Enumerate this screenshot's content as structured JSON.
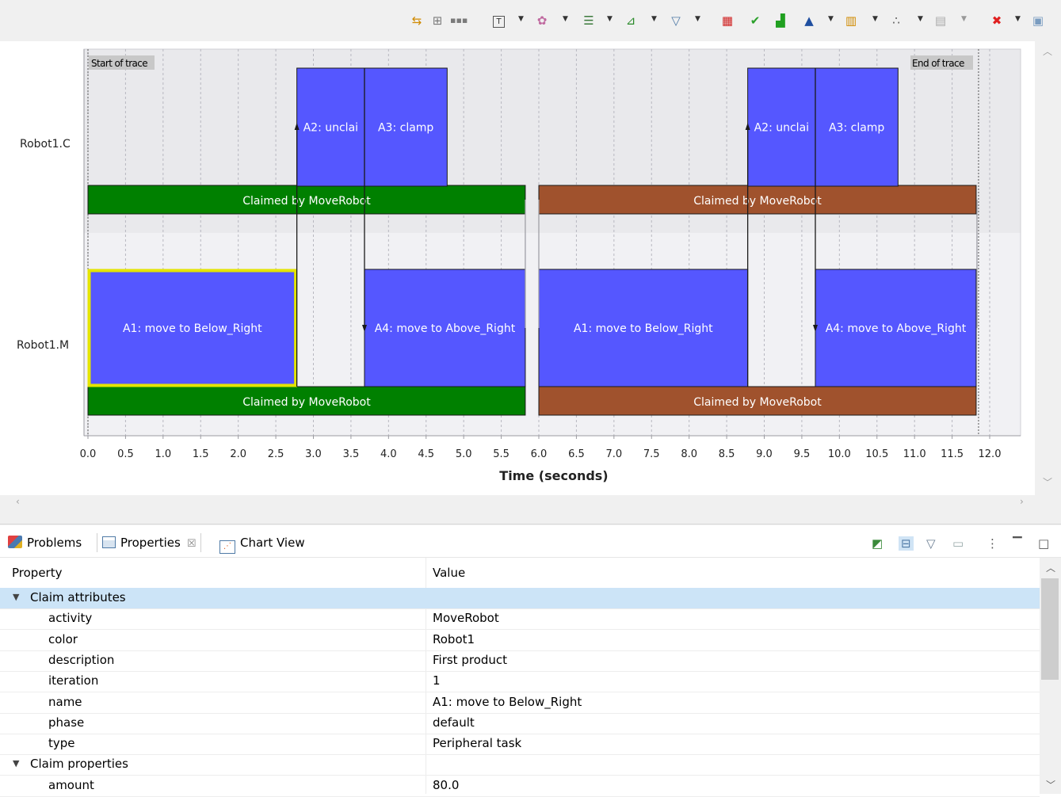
{
  "toolbar": {
    "icons": [
      "sync-icon",
      "hierarchy-icon",
      "ellipsis-icon",
      "text-icon",
      "color-palette-icon",
      "rows-icon",
      "pin-icon",
      "filter-icon",
      "matrix-icon",
      "check-icon",
      "histogram-icon",
      "triangle-icon",
      "bar-chart-icon",
      "scatter-icon",
      "columns-icon",
      "delete-icon",
      "save-icon"
    ]
  },
  "chart": {
    "start_label": "Start of trace",
    "end_label": "End of trace",
    "xlabel": "Time (seconds)",
    "rows": [
      "Robot1.C",
      "Robot1.M"
    ],
    "ticks": [
      "0.0",
      "0.5",
      "1.0",
      "1.5",
      "2.0",
      "2.5",
      "3.0",
      "3.5",
      "4.0",
      "4.5",
      "5.0",
      "5.5",
      "6.0",
      "6.5",
      "7.0",
      "7.5",
      "8.0",
      "8.5",
      "9.0",
      "9.5",
      "10.0",
      "10.5",
      "11.0",
      "11.5",
      "12.0"
    ]
  },
  "chart_data": {
    "type": "gantt",
    "xlabel": "Time (seconds)",
    "xlim": [
      0.0,
      12.0
    ],
    "rows": [
      "Robot1.C",
      "Robot1.M"
    ],
    "colors": {
      "task": "#5557ff",
      "claim_1": "#008000",
      "claim_2": "#a0522d",
      "selected": "#e4e400"
    },
    "tasks": [
      {
        "row": 0,
        "label": "A2: unclai",
        "start": 2.78,
        "end": 3.68
      },
      {
        "row": 0,
        "label": "A3: clamp",
        "start": 3.68,
        "end": 4.78
      },
      {
        "row": 0,
        "label": "A2: unclai",
        "start": 8.78,
        "end": 9.68
      },
      {
        "row": 0,
        "label": "A3: clamp",
        "start": 9.68,
        "end": 10.78
      },
      {
        "row": 1,
        "label": "A1: move to Below_Right",
        "start": 0.0,
        "end": 2.78,
        "selected": true
      },
      {
        "row": 1,
        "label": "A4: move to Above_Right",
        "start": 3.68,
        "end": 5.82
      },
      {
        "row": 1,
        "label": "A1: move to Below_Right",
        "start": 6.0,
        "end": 8.78
      },
      {
        "row": 1,
        "label": "A4: move to Above_Right",
        "start": 9.68,
        "end": 11.82
      }
    ],
    "claims": [
      {
        "row": 0,
        "label": "Claimed by MoveRobot",
        "start": 0.0,
        "end": 5.82,
        "color": "#008000"
      },
      {
        "row": 0,
        "label": "Claimed by MoveRobot",
        "start": 6.0,
        "end": 11.82,
        "color": "#a0522d"
      },
      {
        "row": 1,
        "label": "Claimed by MoveRobot",
        "start": 0.0,
        "end": 5.82,
        "color": "#008000"
      },
      {
        "row": 1,
        "label": "Claimed by MoveRobot",
        "start": 6.0,
        "end": 11.82,
        "color": "#a0522d"
      }
    ],
    "dependencies": [
      {
        "from_row": 1,
        "to_row": 0,
        "time": 2.78
      },
      {
        "from_row": 0,
        "to_row": 1,
        "time": 3.68
      },
      {
        "from_row": 1,
        "to_row": 0,
        "time": 8.78
      },
      {
        "from_row": 0,
        "to_row": 1,
        "time": 9.68
      }
    ]
  },
  "tabs": [
    {
      "label": "Problems",
      "icon": "problems-icon"
    },
    {
      "label": "Properties",
      "icon": "properties-icon",
      "active": true,
      "close": "☒"
    },
    {
      "label": "Chart View",
      "icon": "chart-view-icon"
    }
  ],
  "view_icons": [
    "pin-icon",
    "tree-icon",
    "filter-icon",
    "restore-icon",
    "more-icon",
    "minimize-icon",
    "maximize-icon"
  ],
  "properties": {
    "col_property": "Property",
    "col_value": "Value",
    "rows": [
      {
        "name": "Claim attributes",
        "value": "",
        "group": true,
        "selected": true
      },
      {
        "name": "activity",
        "value": "MoveRobot"
      },
      {
        "name": "color",
        "value": "Robot1"
      },
      {
        "name": "description",
        "value": "First product"
      },
      {
        "name": "iteration",
        "value": "1"
      },
      {
        "name": "name",
        "value": "A1: move to Below_Right"
      },
      {
        "name": "phase",
        "value": "default"
      },
      {
        "name": "type",
        "value": "Peripheral task"
      },
      {
        "name": "Claim properties",
        "value": "",
        "group": true
      },
      {
        "name": "amount",
        "value": "80.0"
      }
    ]
  }
}
